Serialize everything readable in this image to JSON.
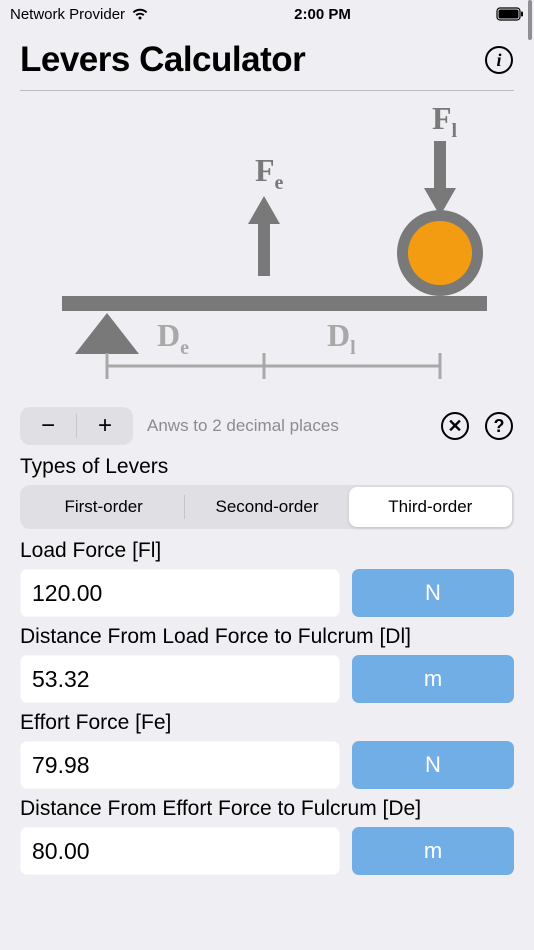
{
  "status_bar": {
    "carrier": "Network Provider",
    "time": "2:00 PM"
  },
  "header": {
    "title": "Levers Calculator"
  },
  "diagram": {
    "label_fl": "F",
    "label_fl_sub": "l",
    "label_fe": "F",
    "label_fe_sub": "e",
    "label_dl": "D",
    "label_dl_sub": "l",
    "label_de": "D",
    "label_de_sub": "e"
  },
  "controls": {
    "minus": "−",
    "plus": "+",
    "hint": "Anws to 2 decimal places",
    "x_glyph": "✕",
    "q_glyph": "?"
  },
  "types": {
    "label": "Types of Levers",
    "options": [
      "First-order",
      "Second-order",
      "Third-order"
    ],
    "selected_index": 2
  },
  "fields": [
    {
      "label": "Load Force [Fl]",
      "value": "120.00",
      "unit": "N"
    },
    {
      "label": "Distance From Load Force to Fulcrum [Dl]",
      "value": "53.32",
      "unit": "m"
    },
    {
      "label": "Effort Force [Fe]",
      "value": "79.98",
      "unit": "N"
    },
    {
      "label": "Distance From Effort Force to Fulcrum [De]",
      "value": "80.00",
      "unit": "m"
    }
  ]
}
